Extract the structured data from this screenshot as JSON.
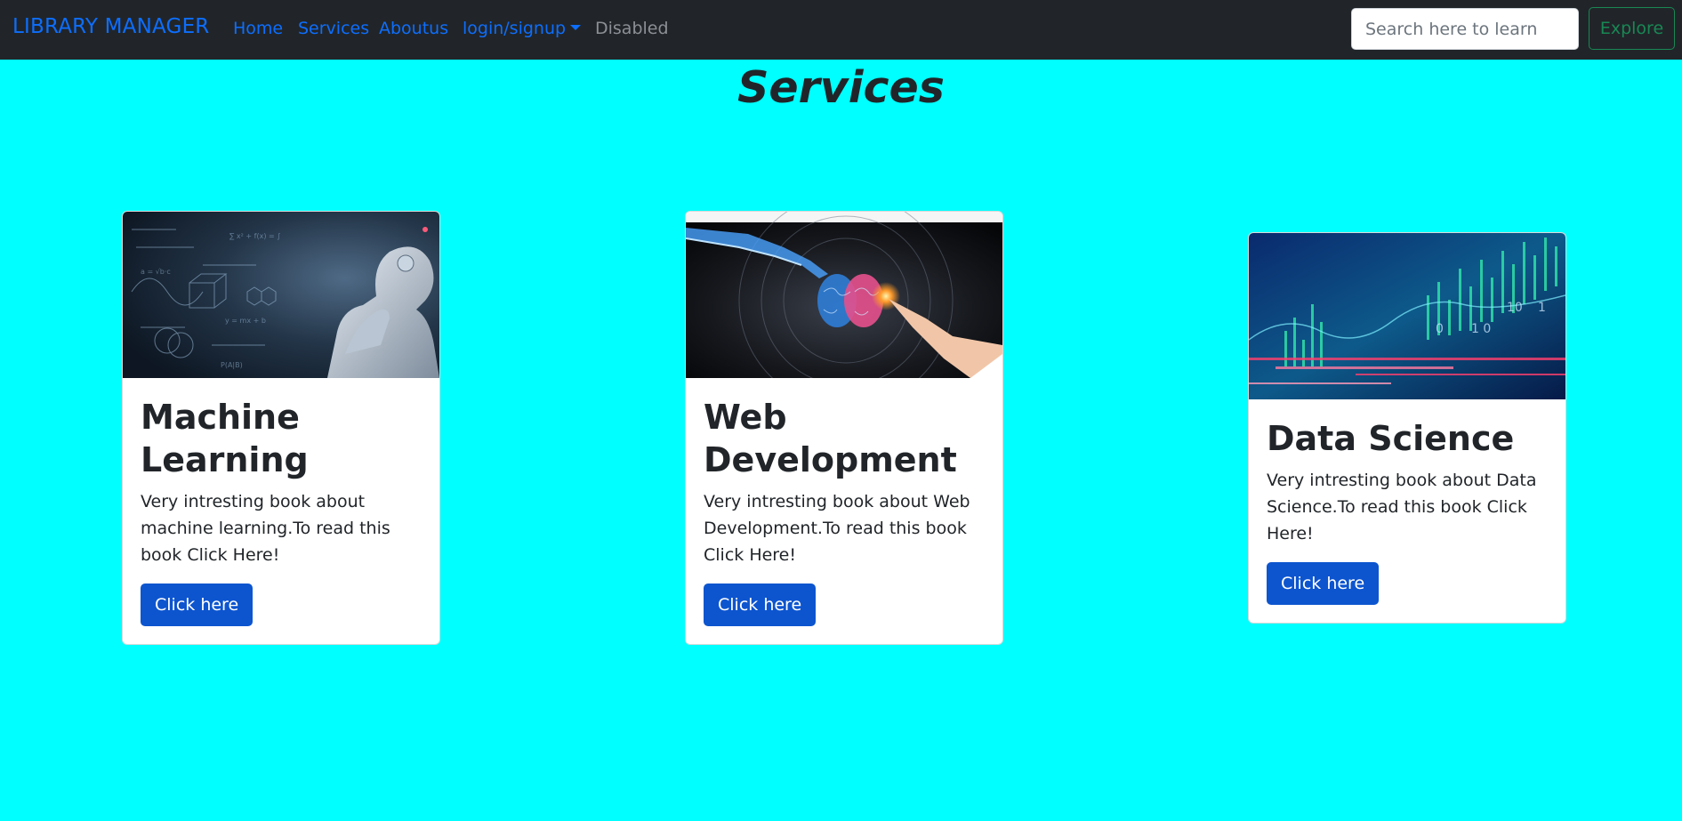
{
  "navbar": {
    "brand": "LIBRARY MANAGER",
    "links": [
      {
        "label": "Home"
      },
      {
        "label": "Services"
      },
      {
        "label": "Aboutus"
      },
      {
        "label": "login/signup"
      },
      {
        "label": "Disabled"
      }
    ],
    "search_placeholder": "Search here to learn",
    "explore_label": "Explore"
  },
  "page": {
    "title": "Services"
  },
  "cards": [
    {
      "title": "Machine Learning",
      "text": "Very intresting book about machine learning.To read this book Click Here!",
      "button": "Click here",
      "image": "robot-thinking-image"
    },
    {
      "title": "Web Development",
      "text": "Very intresting book about Web Development.To read this book Click Here!",
      "button": "Click here",
      "image": "brain-touch-image"
    },
    {
      "title": "Data Science",
      "text": "Very intresting book about Data Science.To read this book Click Here!",
      "button": "Click here",
      "image": "data-visualization-image"
    }
  ],
  "colors": {
    "background": "#00ffff",
    "navbar": "#212529",
    "link": "#0d6efd",
    "button": "#0d55cf",
    "explore": "#198754"
  }
}
